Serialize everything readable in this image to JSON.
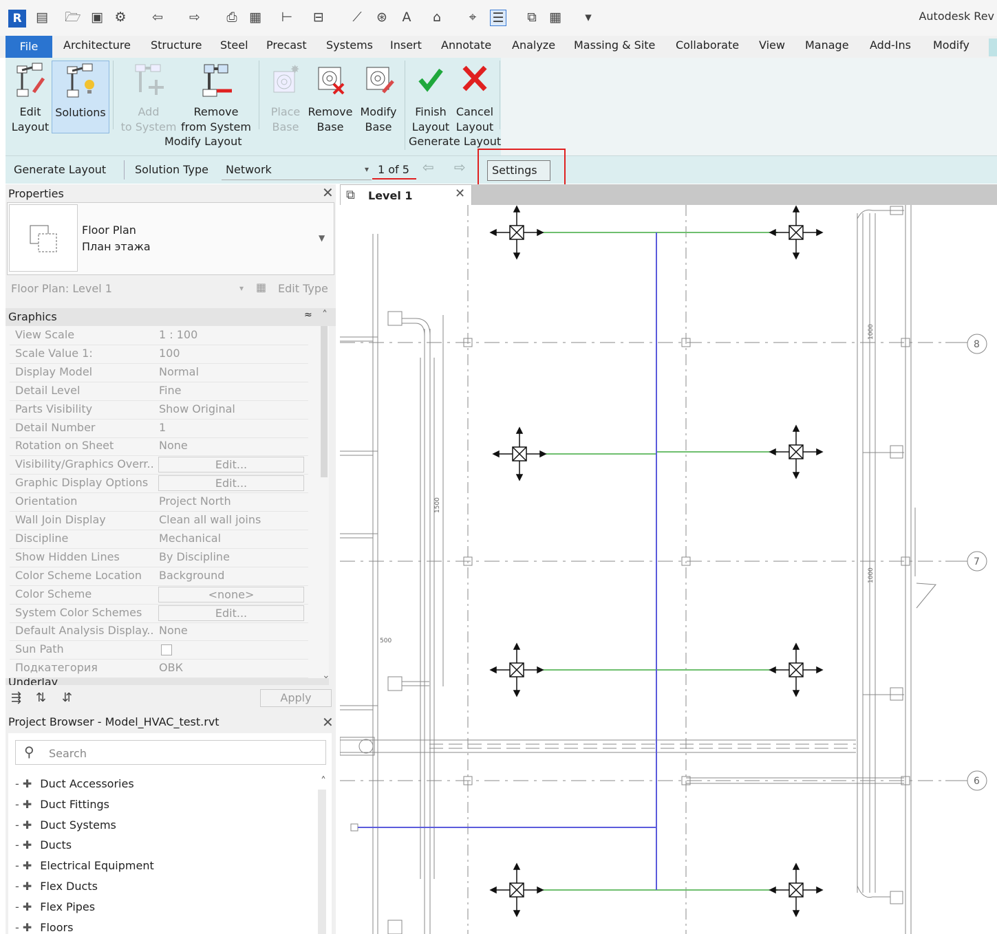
{
  "app": {
    "title": "Autodesk Rev"
  },
  "tabs": [
    "File",
    "Architecture",
    "Structure",
    "Steel",
    "Precast",
    "Systems",
    "Insert",
    "Annotate",
    "Analyze",
    "Massing & Site",
    "Collaborate",
    "View",
    "Manage",
    "Add-Ins",
    "Modify"
  ],
  "ribbon": {
    "edit_layout": [
      "Edit",
      "Layout"
    ],
    "solutions": [
      "Solutions"
    ],
    "add_to_system": [
      "Add",
      "to System"
    ],
    "remove_from_system": [
      "Remove",
      "from System"
    ],
    "place_base": [
      "Place",
      "Base"
    ],
    "remove_base": [
      "Remove",
      "Base"
    ],
    "modify_base": [
      "Modify",
      "Base"
    ],
    "finish_layout": [
      "Finish",
      "Layout"
    ],
    "cancel_layout": [
      "Cancel",
      "Layout"
    ],
    "panel_modify": "Modify Layout",
    "panel_generate": "Generate Layout"
  },
  "options_bar": {
    "generate_layout": "Generate Layout",
    "solution_type_label": "Solution Type",
    "solution_type_value": "Network",
    "page": "1 of 5",
    "settings": "Settings ..."
  },
  "properties": {
    "title": "Properties",
    "type_name_1": "Floor Plan",
    "type_name_2": "План этажа",
    "selector": "Floor Plan: Level 1",
    "edit_type": "Edit Type",
    "group": "Graphics",
    "rows": [
      {
        "k": "View Scale",
        "v": "1 : 100"
      },
      {
        "k": "Scale Value    1:",
        "v": "100"
      },
      {
        "k": "Display Model",
        "v": "Normal"
      },
      {
        "k": "Detail Level",
        "v": "Fine"
      },
      {
        "k": "Parts Visibility",
        "v": "Show Original"
      },
      {
        "k": "Detail Number",
        "v": "1"
      },
      {
        "k": "Rotation on Sheet",
        "v": "None"
      },
      {
        "k": "Visibility/Graphics Overr...",
        "v": "Edit...",
        "btn": true
      },
      {
        "k": "Graphic Display Options",
        "v": "Edit...",
        "btn": true
      },
      {
        "k": "Orientation",
        "v": "Project North"
      },
      {
        "k": "Wall Join Display",
        "v": "Clean all wall joins"
      },
      {
        "k": "Discipline",
        "v": "Mechanical"
      },
      {
        "k": "Show Hidden Lines",
        "v": "By Discipline"
      },
      {
        "k": "Color Scheme Location",
        "v": "Background"
      },
      {
        "k": "Color Scheme",
        "v": "<none>",
        "btn": true
      },
      {
        "k": "System Color Schemes",
        "v": "Edit...",
        "btn": true
      },
      {
        "k": "Default Analysis Display...",
        "v": "None"
      },
      {
        "k": "Sun Path",
        "v": ""
      },
      {
        "k": "Подкатегория",
        "v": "ОВК"
      }
    ],
    "underlay": "Underlay",
    "apply": "Apply"
  },
  "project_browser": {
    "title": "Project Browser - Model_HVAC_test.rvt",
    "search_placeholder": "Search",
    "items": [
      "Duct Accessories",
      "Duct Fittings",
      "Duct Systems",
      "Ducts",
      "Electrical Equipment",
      "Flex Ducts",
      "Flex Pipes",
      "Floors"
    ]
  },
  "view": {
    "tab": "Level 1",
    "grid_labels": [
      "8",
      "7",
      "6"
    ],
    "dims": [
      "1000",
      "1000",
      "1500",
      "500"
    ]
  },
  "colors": {
    "file_tab": "#2a74d0",
    "ribbon": "#dceef0",
    "highlight": "#e02020",
    "duct_green": "#6ebf6e",
    "duct_blue": "#5b5bdc"
  }
}
